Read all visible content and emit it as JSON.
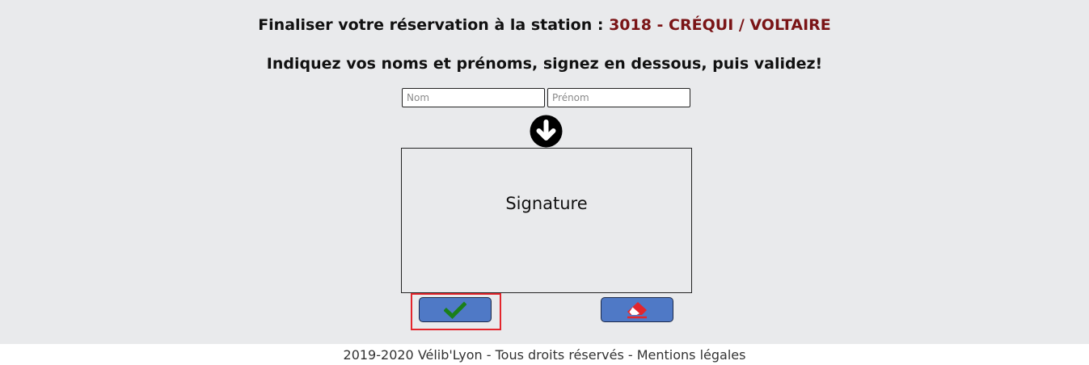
{
  "header": {
    "title_prefix": "Finaliser votre réservation à la station :",
    "station": "3018 - CRÉQUI / VOLTAIRE",
    "instruction": "Indiquez vos noms et prénoms, signez en dessous, puis validez!"
  },
  "form": {
    "nom_placeholder": "Nom",
    "prenom_placeholder": "Prénom",
    "nom_value": "",
    "prenom_value": ""
  },
  "signature": {
    "label": "Signature"
  },
  "icons": {
    "arrow": "arrow-circle-down-icon",
    "validate": "check-icon",
    "clear": "eraser-icon"
  },
  "colors": {
    "station": "#7a1416",
    "button": "#4f79c6",
    "check": "#1a7f1a",
    "eraser": "#e3262c",
    "focus_ring": "#e3262c"
  },
  "footer": {
    "text": "2019-2020 Vélib'Lyon - Tous droits réservés - Mentions légales"
  }
}
